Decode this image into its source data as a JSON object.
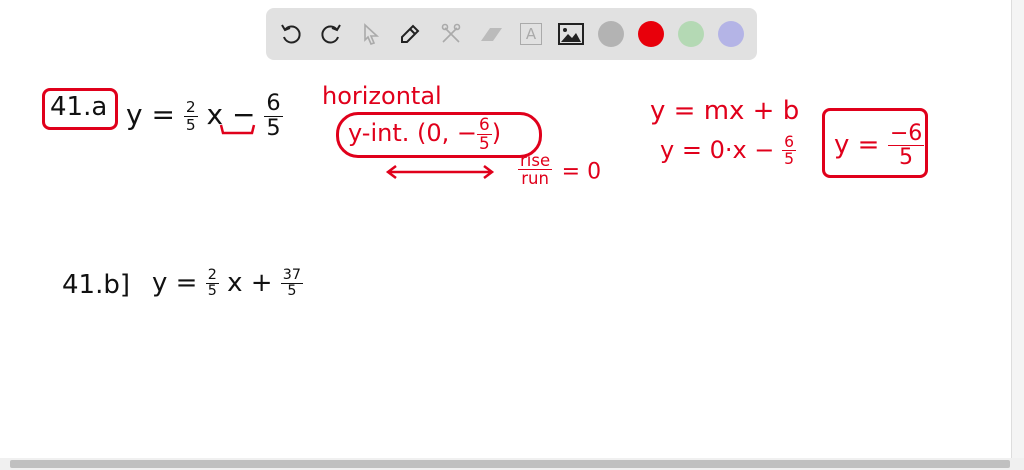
{
  "toolbar": {
    "tools": [
      "undo-icon",
      "redo-icon",
      "pointer-icon",
      "pencil-icon",
      "tools-icon",
      "eraser-icon",
      "text-icon",
      "image-icon"
    ],
    "colors": {
      "gray": "#b3b3b3",
      "red": "#e8000b",
      "green": "#b4d9b4",
      "purple": "#b4b4e6"
    },
    "text_tool_label": "A"
  },
  "board": {
    "a_label": "41.a",
    "a_eq_y": "y =",
    "a_slope_n": "2",
    "a_slope_d": "5",
    "a_x_minus": "x −",
    "a_int_n": "6",
    "a_int_d": "5",
    "horizontal": "horizontal",
    "yint": "y-int. (0, −",
    "yint_n": "6",
    "yint_d": "5",
    "yint_close": ")",
    "rise": "rise",
    "run": "run",
    "eq_zero": "= 0",
    "mxb": "y = mx + b",
    "sub_start": "y = 0·x −",
    "sub_n": "6",
    "sub_d": "5",
    "final_y": "y =",
    "final_n": "−6",
    "final_d": "5",
    "b_label": "41.b]",
    "b_eq_y": "y =",
    "b_slope_n": "2",
    "b_slope_d": "5",
    "b_x_plus": "x +",
    "b_int_n": "37",
    "b_int_d": "5"
  }
}
